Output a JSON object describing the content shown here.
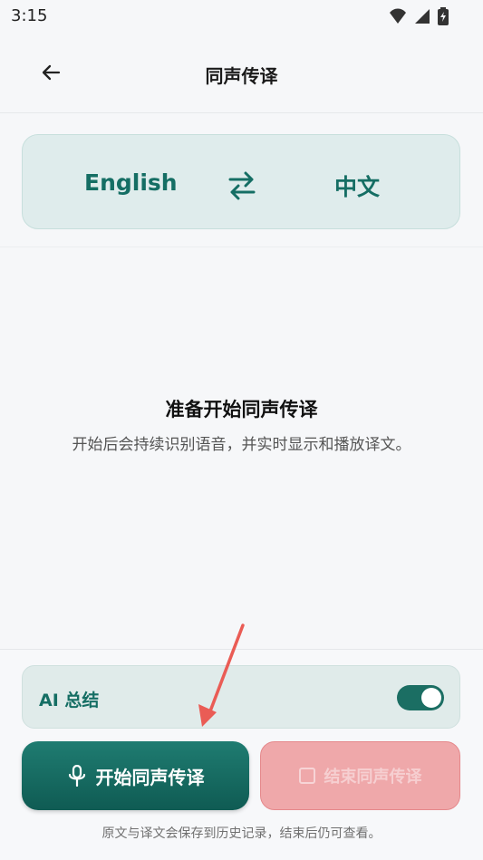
{
  "status_bar": {
    "time": "3:15",
    "icons": [
      "wifi-icon",
      "signal-icon",
      "battery-icon"
    ]
  },
  "header": {
    "title": "同声传译"
  },
  "language_selector": {
    "source": "English",
    "target": "中文",
    "swap_icon": "swap-icon"
  },
  "empty_state": {
    "title": "准备开始同声传译",
    "description": "开始后会持续识别语音，并实时显示和播放译文。"
  },
  "ai_summary": {
    "label": "AI 总结",
    "enabled": true
  },
  "actions": {
    "start_label": "开始同声传译",
    "stop_label": "结束同声传译"
  },
  "footer": {
    "note": "原文与译文会保存到历史记录，结束后仍可查看。"
  },
  "colors": {
    "accent": "#156e64",
    "danger": "#efa8aa",
    "background": "#f6f7f9"
  }
}
